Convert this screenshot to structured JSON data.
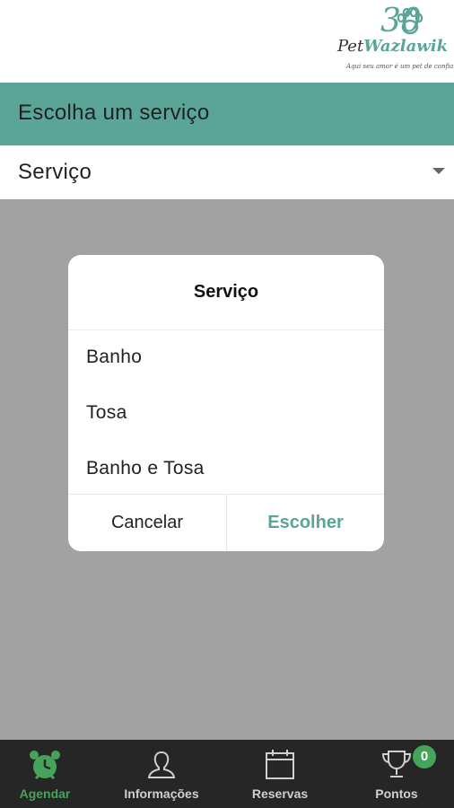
{
  "logo": {
    "number": "30",
    "brand_pet": "Pet",
    "brand_name": "Wazlawik",
    "tagline": "Aqui seu amor é um pet de confiança!"
  },
  "header": {
    "title": "Escolha um serviço"
  },
  "select": {
    "label": "Serviço"
  },
  "dialog": {
    "title": "Serviço",
    "options": [
      "Banho",
      "Tosa",
      "Banho e Tosa"
    ],
    "cancel_label": "Cancelar",
    "choose_label": "Escolher"
  },
  "tabs": [
    {
      "label": "Agendar",
      "icon": "alarm-clock-icon",
      "active": true
    },
    {
      "label": "Informações",
      "icon": "person-icon",
      "active": false
    },
    {
      "label": "Reservas",
      "icon": "calendar-icon",
      "active": false
    },
    {
      "label": "Pontos",
      "icon": "trophy-icon",
      "active": false
    }
  ],
  "points_badge": "0",
  "colors": {
    "accent": "#5aa597",
    "tab_active": "#46a35a",
    "tabbar_bg": "#262626",
    "overlay": "#a2a2a2"
  }
}
